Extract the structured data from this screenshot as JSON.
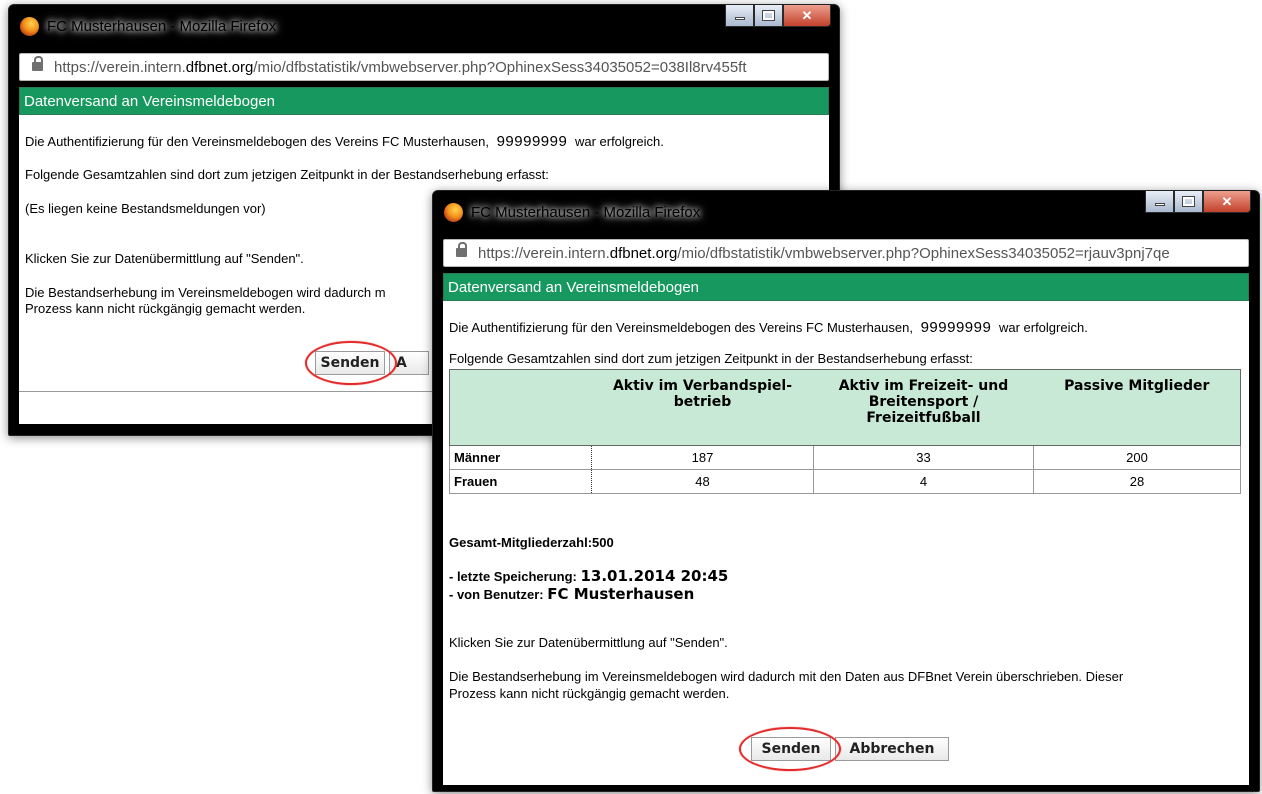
{
  "window1": {
    "title": "FC Musterhausen - Mozilla Firefox",
    "url_prefix": "https://verein.intern.",
    "url_domain": "dfbnet.org",
    "url_rest": "/mio/dfbstatistik/vmbwebserver.php?OphinexSess34035052=038Il8rv455ft",
    "header": "Datenversand an Vereinsmeldebogen",
    "auth_text_before": "Die Authentifizierung für den Vereinsmeldebogen des Vereins FC Musterhausen,",
    "auth_number": "99999999",
    "auth_text_after": "war erfolgreich.",
    "totals_text": "Folgende Gesamtzahlen sind dort zum jetzigen Zeitpunkt in der Bestandserhebung erfasst:",
    "no_entries": "(Es liegen keine Bestandsmeldungen vor)",
    "click_send": "Klicken Sie zur Datenübermittlung auf \"Senden\".",
    "overwrite_line1": "Die Bestandserhebung im Vereinsmeldebogen wird dadurch m",
    "overwrite_line2": "Prozess kann nicht rückgängig gemacht werden.",
    "send_button": "Senden",
    "cancel_button_partial": "A"
  },
  "window2": {
    "title": "FC Musterhausen - Mozilla Firefox",
    "url_prefix": "https://verein.intern.",
    "url_domain": "dfbnet.org",
    "url_rest": "/mio/dfbstatistik/vmbwebserver.php?OphinexSess34035052=rjauv3pnj7qe",
    "header": "Datenversand an Vereinsmeldebogen",
    "auth_text_before": "Die Authentifizierung für den Vereinsmeldebogen des Vereins FC Musterhausen,",
    "auth_number": "99999999",
    "auth_text_after": "war erfolgreich.",
    "totals_text": "Folgende Gesamtzahlen sind dort zum jetzigen Zeitpunkt in der Bestandserhebung erfasst:",
    "table": {
      "headers": [
        "",
        "Aktiv im Verbandspiel-betrieb",
        "Aktiv im Freizeit- und Breitensport / Freizeitfußball",
        "Passive Mitglieder"
      ],
      "rows": [
        {
          "label": "Männer",
          "values": [
            "187",
            "33",
            "200"
          ]
        },
        {
          "label": "Frauen",
          "values": [
            "48",
            "4",
            "28"
          ]
        }
      ]
    },
    "total_members": "Gesamt-Mitgliederzahl:500",
    "last_saved_label": "- letzte Speicherung:",
    "last_saved_value": "13.01.2014 20:45",
    "by_user_label": "- von Benutzer:",
    "by_user_value": "FC Musterhausen",
    "click_send": "Klicken Sie zur Datenübermittlung auf \"Senden\".",
    "overwrite_line1": "Die Bestandserhebung im Vereinsmeldebogen wird dadurch mit den Daten aus DFBnet Verein überschrieben. Dieser",
    "overwrite_line2": "Prozess kann nicht rückgängig gemacht werden.",
    "send_button": "Senden",
    "cancel_button": "Abbrechen"
  },
  "colors": {
    "header_green": "#17985e",
    "table_header_bg": "#c9e9d7",
    "highlight_red": "#e32b2b"
  },
  "icons": {
    "browser": "firefox-icon",
    "lock": "lock-icon"
  }
}
